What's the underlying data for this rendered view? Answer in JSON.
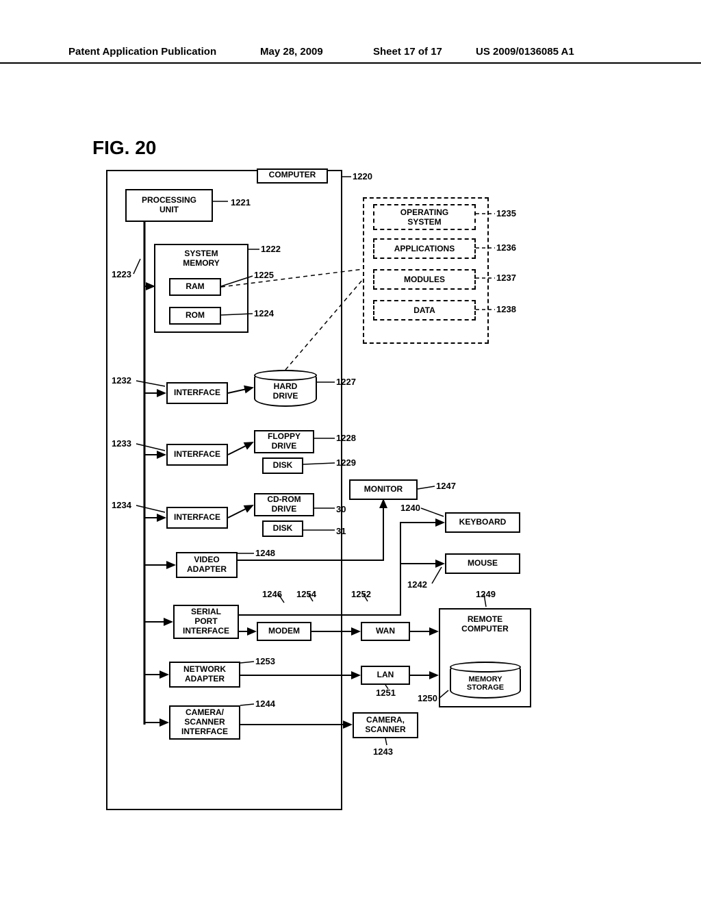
{
  "header": {
    "left": "Patent Application Publication",
    "date": "May 28, 2009",
    "sheet": "Sheet 17 of 17",
    "pubno": "US 2009/0136085 A1"
  },
  "figure_label": "FIG. 20",
  "blocks": {
    "computer": "COMPUTER",
    "processing_unit": "PROCESSING\nUNIT",
    "system_memory": "SYSTEM\nMEMORY",
    "ram": "RAM",
    "rom": "ROM",
    "interface1": "INTERFACE",
    "interface2": "INTERFACE",
    "interface3": "INTERFACE",
    "hard_drive": "HARD\nDRIVE",
    "floppy_drive": "FLOPPY\nDRIVE",
    "floppy_disk": "DISK",
    "cdrom_drive": "CD-ROM\nDRIVE",
    "cdrom_disk": "DISK",
    "video_adapter": "VIDEO\nADAPTER",
    "serial_port": "SERIAL\nPORT\nINTERFACE",
    "modem": "MODEM",
    "network_adapter": "NETWORK\nADAPTER",
    "camera_iface": "CAMERA/\nSCANNER\nINTERFACE",
    "operating_system": "OPERATING\nSYSTEM",
    "applications": "APPLICATIONS",
    "modules": "MODULES",
    "data": "DATA",
    "monitor": "MONITOR",
    "keyboard": "KEYBOARD",
    "mouse": "MOUSE",
    "wan": "WAN",
    "lan": "LAN",
    "remote_computer": "REMOTE\nCOMPUTER",
    "memory_storage": "MEMORY\nSTORAGE",
    "camera_scanner": "CAMERA,\nSCANNER"
  },
  "refs": {
    "r1220": "1220",
    "r1221": "1221",
    "r1222": "1222",
    "r1223": "1223",
    "r1224": "1224",
    "r1225": "1225",
    "r1227": "1227",
    "r1228": "1228",
    "r1229": "1229",
    "r30": "30",
    "r31": "31",
    "r1232": "1232",
    "r1233": "1233",
    "r1234": "1234",
    "r1235": "1235",
    "r1236": "1236",
    "r1237": "1237",
    "r1238": "1238",
    "r1240": "1240",
    "r1242": "1242",
    "r1243": "1243",
    "r1244": "1244",
    "r1246": "1246",
    "r1247": "1247",
    "r1248": "1248",
    "r1249": "1249",
    "r1250": "1250",
    "r1251": "1251",
    "r1252": "1252",
    "r1253": "1253",
    "r1254": "1254"
  }
}
